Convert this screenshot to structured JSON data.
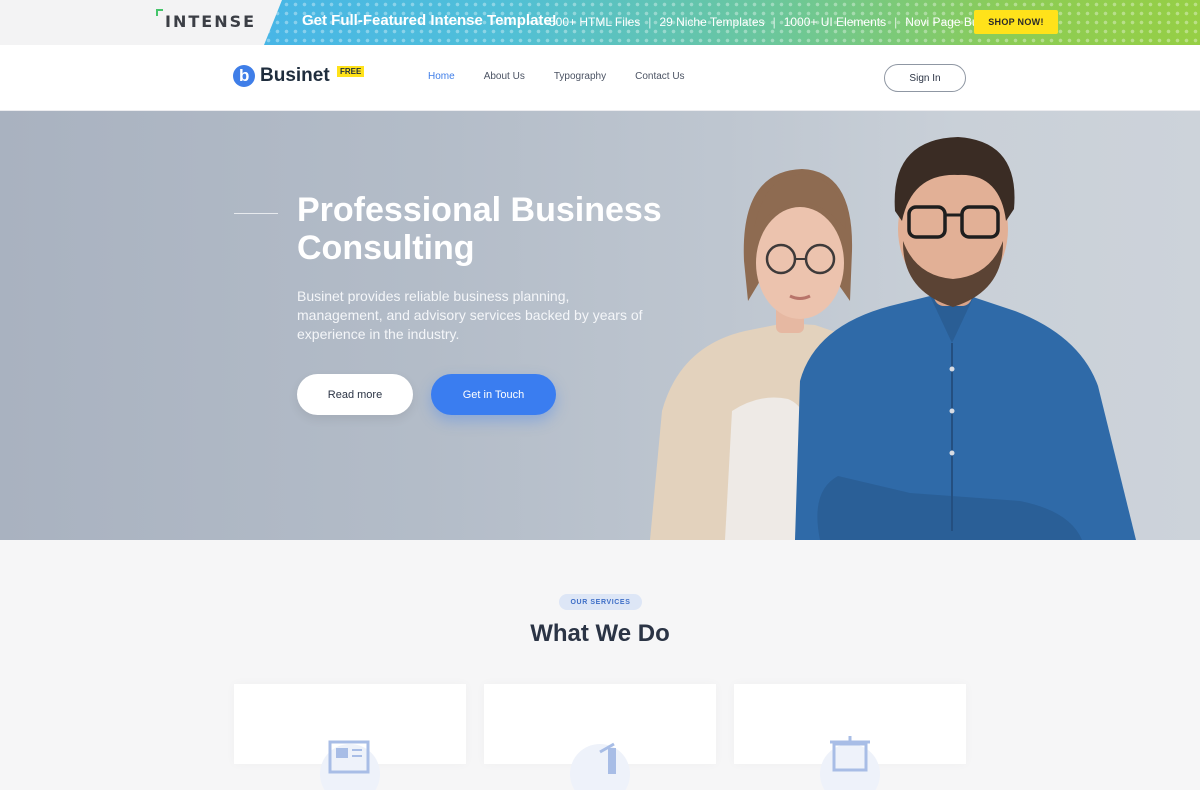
{
  "promo": {
    "brand": "INTENSE",
    "headline": "Get Full-Featured Intense Template!",
    "features": [
      "500+ HTML Files",
      "29 Niche Templates",
      "1000+ UI Elements",
      "Novi Page Builder"
    ],
    "shop_label": "SHOP NOW!"
  },
  "header": {
    "brand_name": "Businet",
    "brand_badge": "FREE",
    "nav": [
      {
        "label": "Home",
        "active": true
      },
      {
        "label": "About Us",
        "active": false
      },
      {
        "label": "Typography",
        "active": false
      },
      {
        "label": "Contact Us",
        "active": false
      }
    ],
    "signin_label": "Sign In"
  },
  "hero": {
    "title": "Professional Business Consulting",
    "text": "Businet provides reliable business planning, management, and advisory services backed by years of experience in the industry.",
    "read_more_label": "Read more",
    "touch_label": "Get in Touch"
  },
  "services": {
    "badge": "OUR SERVICES",
    "title": "What We Do",
    "cards": [
      {
        "icon": "newspaper-icon"
      },
      {
        "icon": "chart-icon"
      },
      {
        "icon": "presentation-board-icon"
      }
    ]
  },
  "colors": {
    "accent": "#3a7df0",
    "promo_button": "#ffe21a",
    "hero_bg": "#b3bcc8"
  }
}
